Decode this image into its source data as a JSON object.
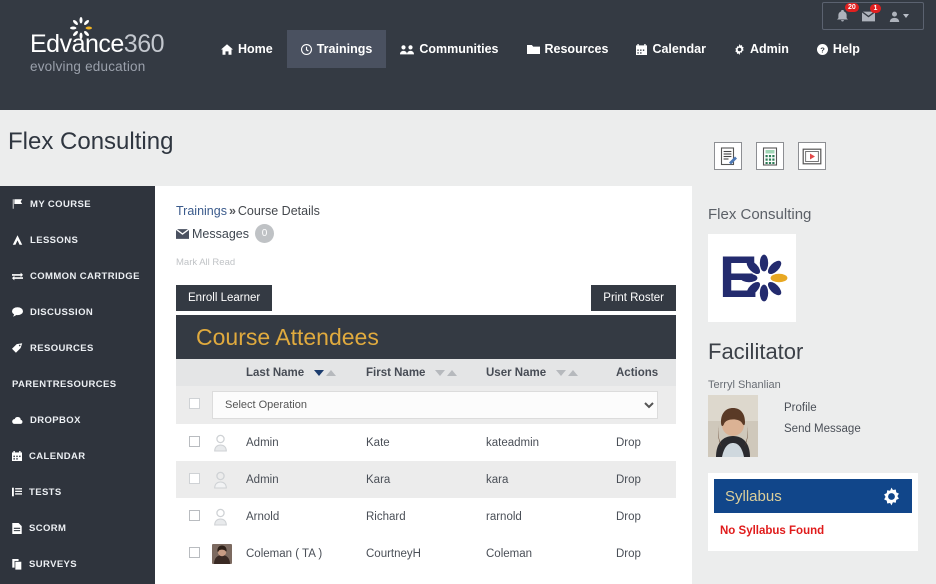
{
  "topnav": {
    "logo": {
      "main_edvance": "Edvance",
      "main_num": "360",
      "sub": "evolving education",
      "icon": "sunburst-icon"
    },
    "items": [
      {
        "label": "Home",
        "icon": "home-icon",
        "active": false
      },
      {
        "label": "Trainings",
        "icon": "clock-icon",
        "active": true
      },
      {
        "label": "Communities",
        "icon": "users-icon",
        "active": false
      },
      {
        "label": "Resources",
        "icon": "folder-icon",
        "active": false
      },
      {
        "label": "Calendar",
        "icon": "calendar-icon",
        "active": false
      },
      {
        "label": "Admin",
        "icon": "gear-icon",
        "active": false
      },
      {
        "label": "Help",
        "icon": "question-circle-icon",
        "active": false
      }
    ],
    "notifications": {
      "bell_icon": "bell-icon",
      "bell_badge": "20",
      "envelope_icon": "envelope-icon",
      "envelope_badge": "1",
      "user_icon": "user-icon"
    }
  },
  "header": {
    "page_title": "Flex Consulting",
    "icons": [
      {
        "name": "notepad-edit-icon"
      },
      {
        "name": "calculator-icon"
      },
      {
        "name": "video-player-icon"
      }
    ]
  },
  "sidebar": {
    "items": [
      {
        "label": "MY COURSE",
        "icon": "flag-icon"
      },
      {
        "label": "LESSONS",
        "icon": "book-icon"
      },
      {
        "label": "COMMON CARTRIDGE",
        "icon": "exchange-icon"
      },
      {
        "label": "DISCUSSION",
        "icon": "comment-icon"
      },
      {
        "label": "RESOURCES",
        "icon": "tag-icon"
      },
      {
        "label": "PARENTRESOURCES",
        "icon": "none"
      },
      {
        "label": "DROPBOX",
        "icon": "cloud-icon"
      },
      {
        "label": "CALENDAR",
        "icon": "calendar-icon"
      },
      {
        "label": "TESTS",
        "icon": "list-icon"
      },
      {
        "label": "SCORM",
        "icon": "file-icon"
      },
      {
        "label": "SURVEYS",
        "icon": "copy-icon"
      }
    ]
  },
  "main": {
    "breadcrumb": {
      "root": "Trainings",
      "separator": "»",
      "current": "Course Details"
    },
    "messages": {
      "label": "Messages",
      "icon": "envelope-icon",
      "count": "0"
    },
    "mark_all_read": "Mark All Read",
    "enroll_button": "Enroll Learner",
    "print_button": "Print Roster",
    "table_title": "Course Attendees",
    "columns": [
      {
        "label": "",
        "key": "check"
      },
      {
        "label": "",
        "key": "avatar"
      },
      {
        "label": "Last Name",
        "key": "last",
        "sortable": true,
        "sort_active": "down"
      },
      {
        "label": "First Name",
        "key": "first",
        "sortable": true,
        "sort_active": "none"
      },
      {
        "label": "User Name",
        "key": "user",
        "sortable": true,
        "sort_active": "none"
      },
      {
        "label": "Actions",
        "key": "actions",
        "sortable": false
      }
    ],
    "operation_select": {
      "value": "Select Operation",
      "options": [
        "Select Operation"
      ]
    },
    "rows": [
      {
        "last": "Admin",
        "first": "Kate",
        "user": "kateadmin",
        "action": "Drop",
        "avatar": "placeholder-user-icon"
      },
      {
        "last": "Admin",
        "first": "Kara",
        "user": "kara",
        "action": "Drop",
        "avatar": "placeholder-user-icon"
      },
      {
        "last": "Arnold",
        "first": "Richard",
        "user": "rarnold",
        "action": "Drop",
        "avatar": "placeholder-user-icon"
      },
      {
        "last": "Coleman ( TA )",
        "first": "CourtneyH",
        "user": "Coleman",
        "action": "Drop",
        "avatar": "profile-photo"
      }
    ]
  },
  "rightpanel": {
    "course_name": "Flex Consulting",
    "course_logo_icon": "edvance-e-logo",
    "facilitator_heading": "Facilitator",
    "facilitator_name": "Terryl Shanlian",
    "facilitator_photo": "facilitator-photo",
    "links": [
      "Profile",
      "Send Message"
    ],
    "syllabus": {
      "title": "Syllabus",
      "gear_icon": "gear-icon",
      "empty_message": "No Syllabus Found"
    }
  },
  "colors": {
    "nav_bg": "#343a43",
    "sidebar_bg": "#2f343d",
    "accent_gold": "#e0aa3e",
    "syllabus_blue": "#11468a",
    "error_red": "#e01b1b",
    "badge_red": "#e02020"
  }
}
